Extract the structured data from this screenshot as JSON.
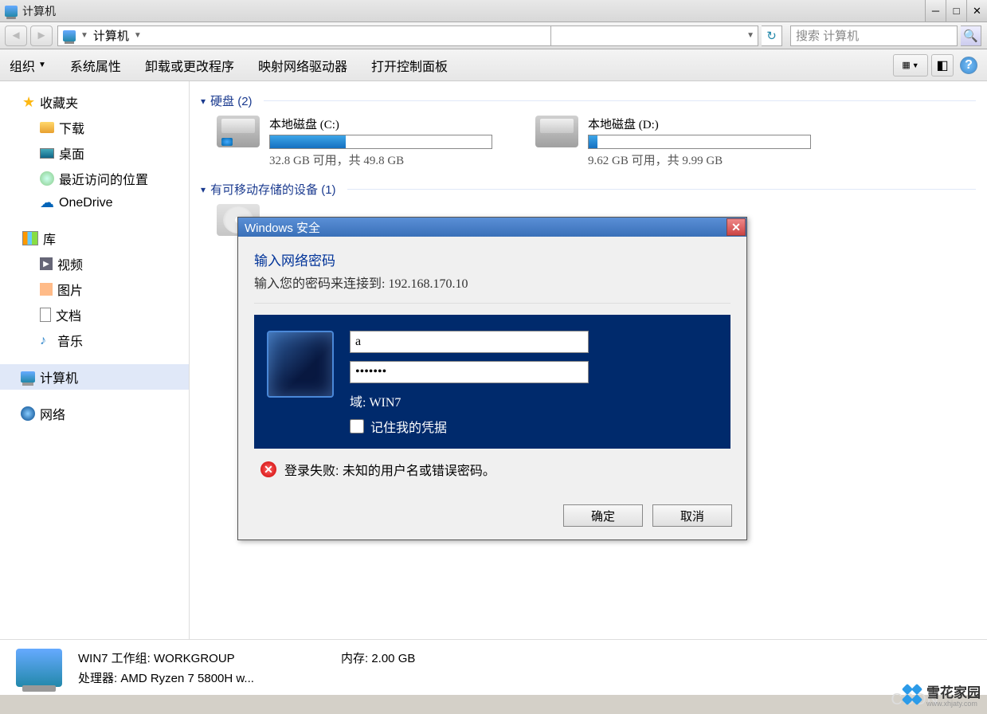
{
  "window": {
    "title": "计算机"
  },
  "nav": {
    "breadcrumb": "计算机",
    "search_placeholder": "搜索 计算机"
  },
  "toolbar": {
    "organize": "组织",
    "sysprops": "系统属性",
    "uninstall": "卸载或更改程序",
    "mapdrive": "映射网络驱动器",
    "ctrlpanel": "打开控制面板"
  },
  "sidebar": {
    "favorites": "收藏夹",
    "downloads": "下载",
    "desktop": "桌面",
    "recent": "最近访问的位置",
    "onedrive": "OneDrive",
    "libraries": "库",
    "videos": "视频",
    "pictures": "图片",
    "documents": "文档",
    "music": "音乐",
    "computer": "计算机",
    "network": "网络"
  },
  "groups": {
    "hdd": "硬盘 (2)",
    "removable": "有可移动存储的设备 (1)"
  },
  "drives": {
    "c": {
      "name": "本地磁盘 (C:)",
      "stat": "32.8 GB 可用，共 49.8 GB",
      "fill_pct": 34
    },
    "d": {
      "name": "本地磁盘 (D:)",
      "stat": "9.62 GB 可用，共 9.99 GB",
      "fill_pct": 4
    }
  },
  "details": {
    "line1": "WIN7 工作组: WORKGROUP",
    "mem": "内存: 2.00 GB",
    "cpu": "处理器: AMD Ryzen 7 5800H w..."
  },
  "dialog": {
    "title": "Windows 安全",
    "heading": "输入网络密码",
    "subtitle": "输入您的密码来连接到: 192.168.170.10",
    "username_value": "a",
    "password_value": "•••••••",
    "domain": "域: WIN7",
    "remember": "记住我的凭据",
    "error": "登录失败: 未知的用户名或错误密码。",
    "ok": "确定",
    "cancel": "取消"
  },
  "watermark": {
    "csdn": "CSDN",
    "brand": "雪花家园",
    "url": "www.xhjaty.com"
  }
}
